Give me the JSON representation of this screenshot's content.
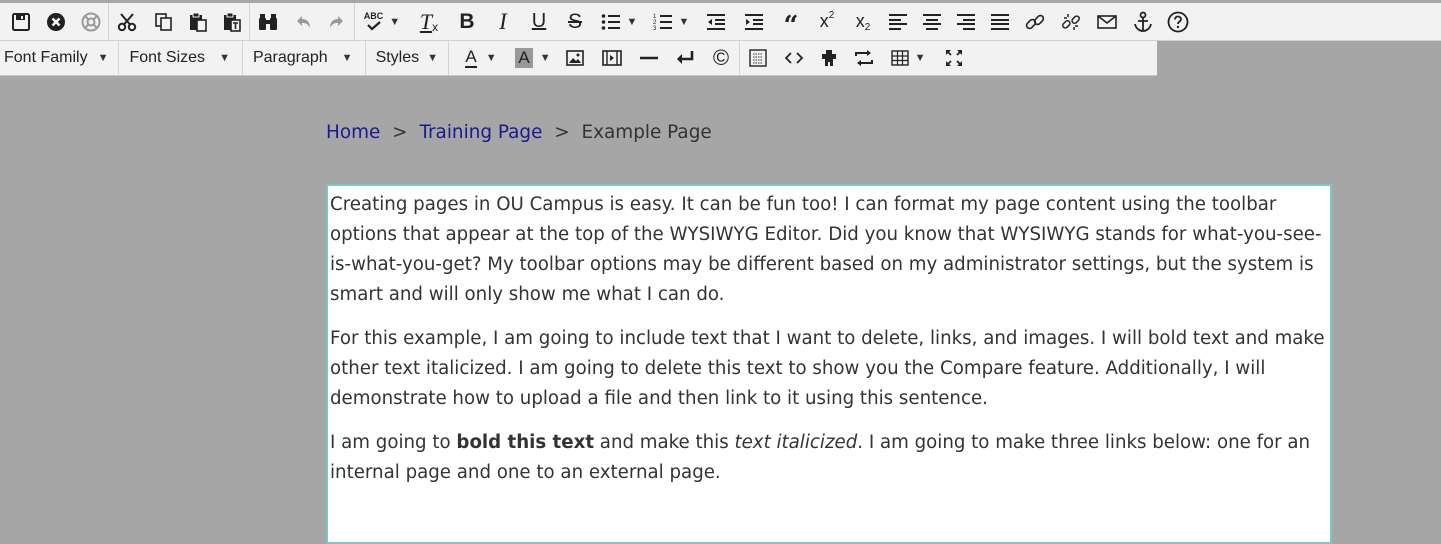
{
  "toolbar1": {
    "spellcheck_label": "ABC"
  },
  "toolbar2": {
    "font_family": "Font Family",
    "font_sizes": "Font Sizes",
    "paragraph": "Paragraph",
    "styles": "Styles",
    "text_color_letter": "A",
    "bg_color_letter": "A",
    "copyright_symbol": "©"
  },
  "breadcrumb": {
    "home": "Home",
    "training": "Training Page",
    "current": "Example Page",
    "separator": ">"
  },
  "content": {
    "p1": "Creating pages in OU Campus is easy. It can be fun too! I can format my page content using the toolbar options that appear at the top of the WYSIWYG Editor. Did you know that WYSIWYG stands for what-you-see-is-what-you-get? My toolbar options may be different based on my administrator settings, but the system is smart and will only show me what I can do.",
    "p2": "For this example, I am going to include text that I want to delete, links, and images. I will bold text and make other text italicized. I am going to delete this text to show you the Compare feature. Additionally, I will demonstrate how to upload a file and then link to it using this sentence.",
    "p3_start": "I am going to ",
    "p3_bold": "bold this text",
    "p3_mid": " and make this ",
    "p3_italic": "text italicized",
    "p3_end": ". I am going to make three links below: one for an internal page and one to an external page."
  },
  "colors": {
    "background": "#a6a6a6",
    "toolbar": "#f2f2f2",
    "editor_border": "#7fc4c8",
    "link": "#1a1a8c"
  }
}
